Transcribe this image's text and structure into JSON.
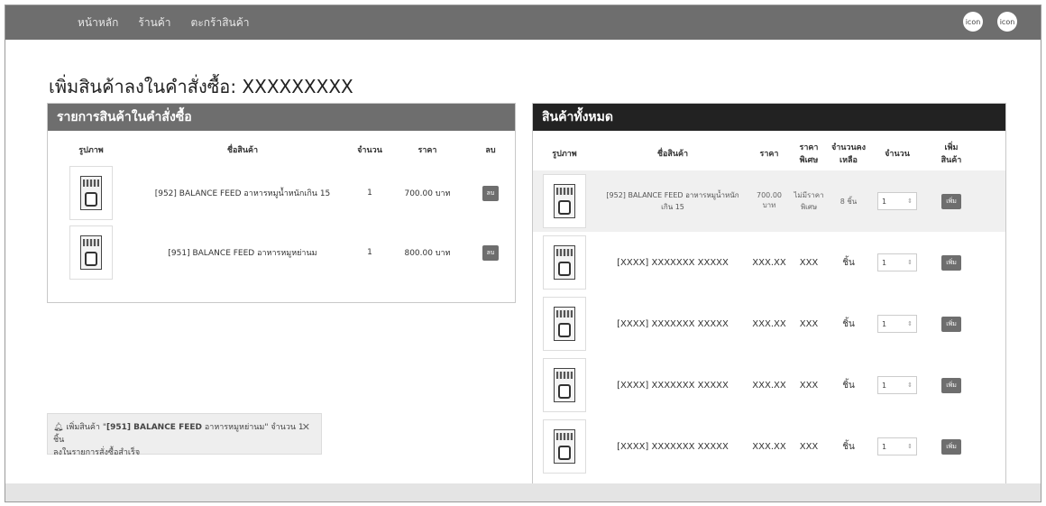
{
  "nav": {
    "links": [
      "หน้าหลัก",
      "ร้านค้า",
      "ตะกร้าสินค้า"
    ],
    "icons": [
      {
        "label": "icon",
        "icon": "user-icon"
      },
      {
        "label": "icon",
        "icon": "settings-icon"
      }
    ]
  },
  "page": {
    "title": "เพิ่มสินค้าลงในคำสั่งซื้อ: XXXXXXXXX"
  },
  "order_panel": {
    "title": "รายการสินค้าในคำสั่งซื้อ",
    "headers": [
      "รูปภาพ",
      "ชื่อสินค้า",
      "จำนวน",
      "ราคา",
      "ลบ"
    ],
    "rows": [
      {
        "name": "[952] BALANCE FEED อาหารหมูน้ำหนักเกิน 15",
        "qty": "1",
        "price": "700.00 บาท",
        "delete_label": "ลบ"
      },
      {
        "name": "[951] BALANCE FEED อาหารหมูหย่านม",
        "qty": "1",
        "price": "800.00 บาท",
        "delete_label": "ลบ"
      }
    ]
  },
  "products_panel": {
    "title": "สินค้าทั้งหมด",
    "headers": {
      "image": "รูปภาพ",
      "name": "ชื่อสินค้า",
      "price": "ราคา",
      "special_1": "ราคา",
      "special_2": "พิเศษ",
      "stock_1": "จำนวนคง",
      "stock_2": "เหลือ",
      "qty": "จำนวน",
      "add_1": "เพิ่ม",
      "add_2": "สินค้า"
    },
    "rows": [
      {
        "name": "[952] BALANCE FEED อาหารหมูน้ำหนัก",
        "name_line2": "เกิน 15",
        "price": "700.00",
        "price_line2": "บาท",
        "special": "ไม่มีราคา",
        "special_line2": "พิเศษ",
        "stock": "8 ชิ้น",
        "qty": "1",
        "add_label": "เพิ่ม"
      },
      {
        "name": "[XXXX] XXXXXXX XXXXX",
        "price": "XXX.XX",
        "special": "XXX",
        "stock": "ชิ้น",
        "qty": "1",
        "add_label": "เพิ่ม"
      },
      {
        "name": "[XXXX] XXXXXXX XXXXX",
        "price": "XXX.XX",
        "special": "XXX",
        "stock": "ชิ้น",
        "qty": "1",
        "add_label": "เพิ่ม"
      },
      {
        "name": "[XXXX] XXXXXXX XXXXX",
        "price": "XXX.XX",
        "special": "XXX",
        "stock": "ชิ้น",
        "qty": "1",
        "add_label": "เพิ่ม"
      },
      {
        "name": "[XXXX] XXXXXXX XXXXX",
        "price": "XXX.XX",
        "special": "XXX",
        "stock": "ชิ้น",
        "qty": "1",
        "add_label": "เพิ่ม"
      }
    ]
  },
  "toast": {
    "prefix": "เพิ่มสินค้า \"",
    "product": "[951] BALANCE FEED",
    "message": " อาหารหมูหย่านม\" จำนวน 1 ชิ้น",
    "line2": "ลงในรายการสั่งซื้อสำเร็จ",
    "icon": "bell-icon"
  }
}
